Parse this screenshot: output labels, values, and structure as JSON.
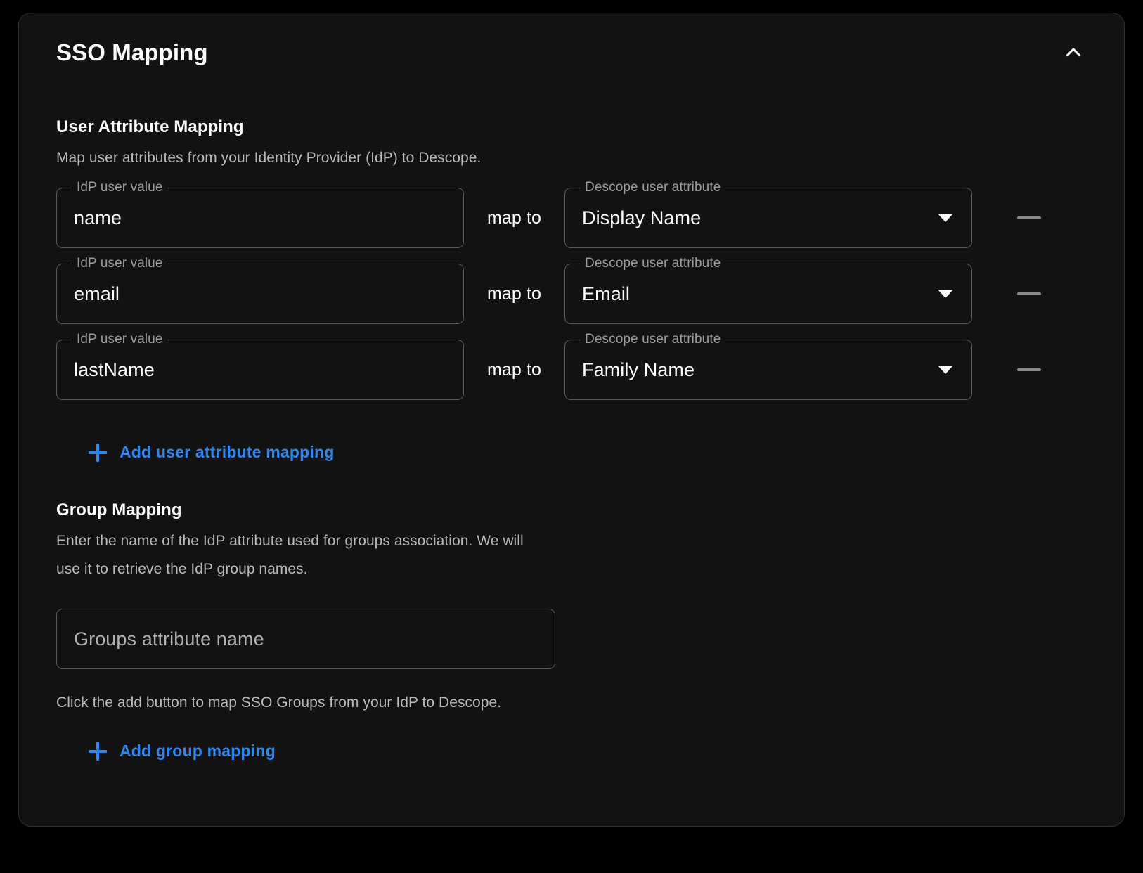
{
  "card": {
    "title": "SSO Mapping",
    "collapse_icon": "chevron-up-icon",
    "collapsed": false
  },
  "user_attribute_mapping": {
    "heading": "User Attribute Mapping",
    "description": "Map user attributes from your Identity Provider (IdP) to Descope.",
    "idp_field_legend": "IdP user value",
    "attribute_field_legend": "Descope user attribute",
    "map_to_label": "map to",
    "remove_icon": "minus-icon",
    "dropdown_icon": "chevron-down-icon",
    "rows": [
      {
        "idp_value": "name",
        "descope_attribute": "Display Name"
      },
      {
        "idp_value": "email",
        "descope_attribute": "Email"
      },
      {
        "idp_value": "lastName",
        "descope_attribute": "Family Name"
      }
    ],
    "add_label": "Add user attribute mapping",
    "add_icon": "plus-icon"
  },
  "group_mapping": {
    "heading": "Group Mapping",
    "description": "Enter the name of the IdP attribute used for groups association. We will use it to retrieve the IdP group names.",
    "input_placeholder": "Groups attribute name",
    "input_value": "",
    "hint": "Click the add button to map SSO Groups from your IdP to Descope.",
    "add_label": "Add group mapping",
    "add_icon": "plus-icon"
  },
  "colors": {
    "page_background": "#000000",
    "card_background": "#121212",
    "card_border": "#2e2e2e",
    "field_border": "#5a5a5a",
    "text_primary": "#ffffff",
    "text_secondary": "#b9b9b9",
    "legend_text": "#9a9a9a",
    "accent_link": "#2b88f0",
    "minus_icon": "#8a8a8a"
  }
}
